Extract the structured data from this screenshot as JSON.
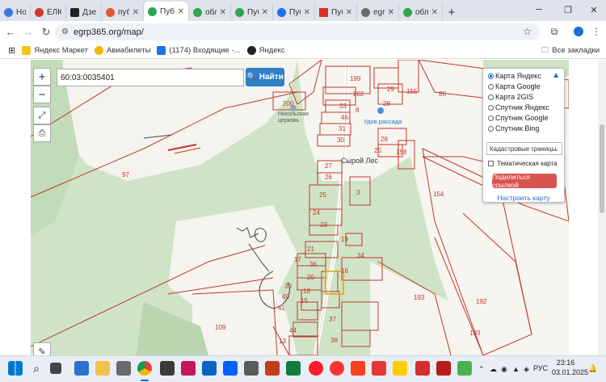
{
  "tabs": [
    {
      "title": "Ноя",
      "color": "#3d7bd8"
    },
    {
      "title": "ЕЛК",
      "color": "#d33a2c"
    },
    {
      "title": "Дзе",
      "color": "#222222"
    },
    {
      "title": "публ",
      "color": "#e05a2b"
    },
    {
      "title": "Пуб",
      "color": "#2ea44f",
      "active": true
    },
    {
      "title": "обл",
      "color": "#2ea44f"
    },
    {
      "title": "Пуб",
      "color": "#2ea44f"
    },
    {
      "title": "Пуб",
      "color": "#1a73e8"
    },
    {
      "title": "Пуб",
      "color": "#d93025"
    },
    {
      "title": "egr",
      "color": "#6a6a6a"
    },
    {
      "title": "обл",
      "color": "#2ea44f"
    }
  ],
  "window_controls": {
    "minimize": "─",
    "maximize": "❐",
    "close": "✕"
  },
  "address": {
    "url": "egrp365.org/map/"
  },
  "bookmarks": [
    {
      "label": "Яндекс Маркет",
      "color": "#f5c518"
    },
    {
      "label": "Авиабилеты",
      "color": "#f2b705"
    },
    {
      "label": "(1174) Входящие -...",
      "color": "#1a73e8"
    },
    {
      "label": "Яндекс",
      "color": "#222222"
    }
  ],
  "all_bookmarks": "Все закладки",
  "map": {
    "search_value": "60:03:0035401",
    "search_button": "Найти",
    "zoom_in": "+",
    "zoom_out": "−",
    "layers": [
      {
        "label": "Карта Яндекс",
        "selected": true
      },
      {
        "label": "Карта Google",
        "selected": false
      },
      {
        "label": "Карта 2GIS",
        "selected": false
      },
      {
        "label": "Спутник Яндекс",
        "selected": false
      },
      {
        "label": "Спутник Google",
        "selected": false
      },
      {
        "label": "Спутник Bing",
        "selected": false
      }
    ],
    "overlay_select": "Кадастровые границы",
    "topo_checkbox": "Тематическая карта",
    "share_button": "Поделиться ссылкой",
    "settings_link": "Настроить карту",
    "places": {
      "church": "Никольская церковь",
      "nursery": "Удов рассада",
      "village": "Сырой Лес"
    },
    "parcel_numbers": [
      "199",
      "202",
      "29",
      "155",
      "86",
      "200",
      "33",
      "28",
      "8",
      "46",
      "31",
      "30",
      "26",
      "25",
      "158",
      "27",
      "26",
      "3",
      "25",
      "154",
      "24",
      "23",
      "97",
      "19",
      "21",
      "34",
      "17",
      "36",
      "16",
      "20",
      "39",
      "18",
      "193",
      "40",
      "15",
      "41",
      "37",
      "109",
      "44",
      "13",
      "38",
      "192",
      "193"
    ]
  },
  "taskbar": {
    "lang": "РУС",
    "time": "23:16",
    "date": "03.01.2025"
  }
}
